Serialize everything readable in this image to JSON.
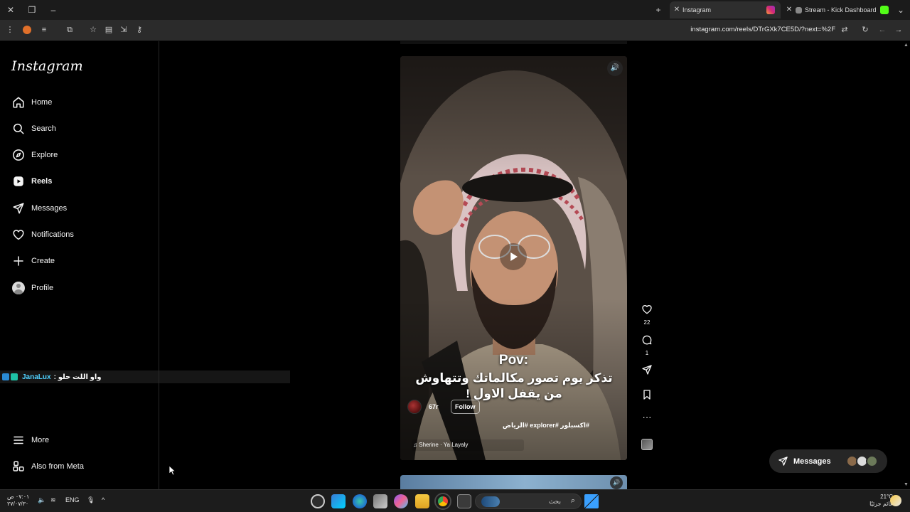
{
  "browser": {
    "tabs": [
      {
        "label": "Instagram",
        "active": true
      },
      {
        "label": "Stream - Kick Dashboard",
        "active": false
      }
    ],
    "url": "instagram.com/reels/DTrGXk7CE5D/?next=%2F"
  },
  "sidebar": {
    "logo": "Instagram",
    "items": [
      {
        "label": "Home",
        "icon": "home-icon"
      },
      {
        "label": "Search",
        "icon": "search-icon"
      },
      {
        "label": "Explore",
        "icon": "explore-icon"
      },
      {
        "label": "Reels",
        "icon": "reels-icon",
        "active": true
      },
      {
        "label": "Messages",
        "icon": "messages-icon"
      },
      {
        "label": "Notifications",
        "icon": "heart-icon"
      },
      {
        "label": "Create",
        "icon": "plus-icon"
      },
      {
        "label": "Profile",
        "icon": "avatar-icon"
      }
    ],
    "bottom": [
      {
        "label": "More",
        "icon": "menu-icon"
      },
      {
        "label": "Also from Meta",
        "icon": "meta-icon"
      }
    ]
  },
  "stream_chat": {
    "user": "JanaLux",
    "message": ": واو اللت حلو"
  },
  "reel": {
    "caption_title": "Pov:",
    "caption_text": "تذكر يوم تصور مكالماتك وتتهاوش من يقفل الاول !",
    "author": "67r",
    "follow_label": "Follow",
    "hashtags": "#اكسبلور #explorer #الرياض",
    "audio": "Sherine · Ya Layaly",
    "likes": "22",
    "comments": "1"
  },
  "messages_pill": {
    "label": "Messages"
  },
  "taskbar": {
    "time": "٠٧:٠١ ص",
    "date": "٢٧/٠٧/٣٠",
    "lang": "ENG",
    "search_placeholder": "بحث",
    "temperature": "21°C",
    "weather": "غائم جزئيًا"
  },
  "colors": {
    "instagram_bg": "#000000",
    "pill_bg": "#262626",
    "chat_user": "#4fd1ff"
  }
}
